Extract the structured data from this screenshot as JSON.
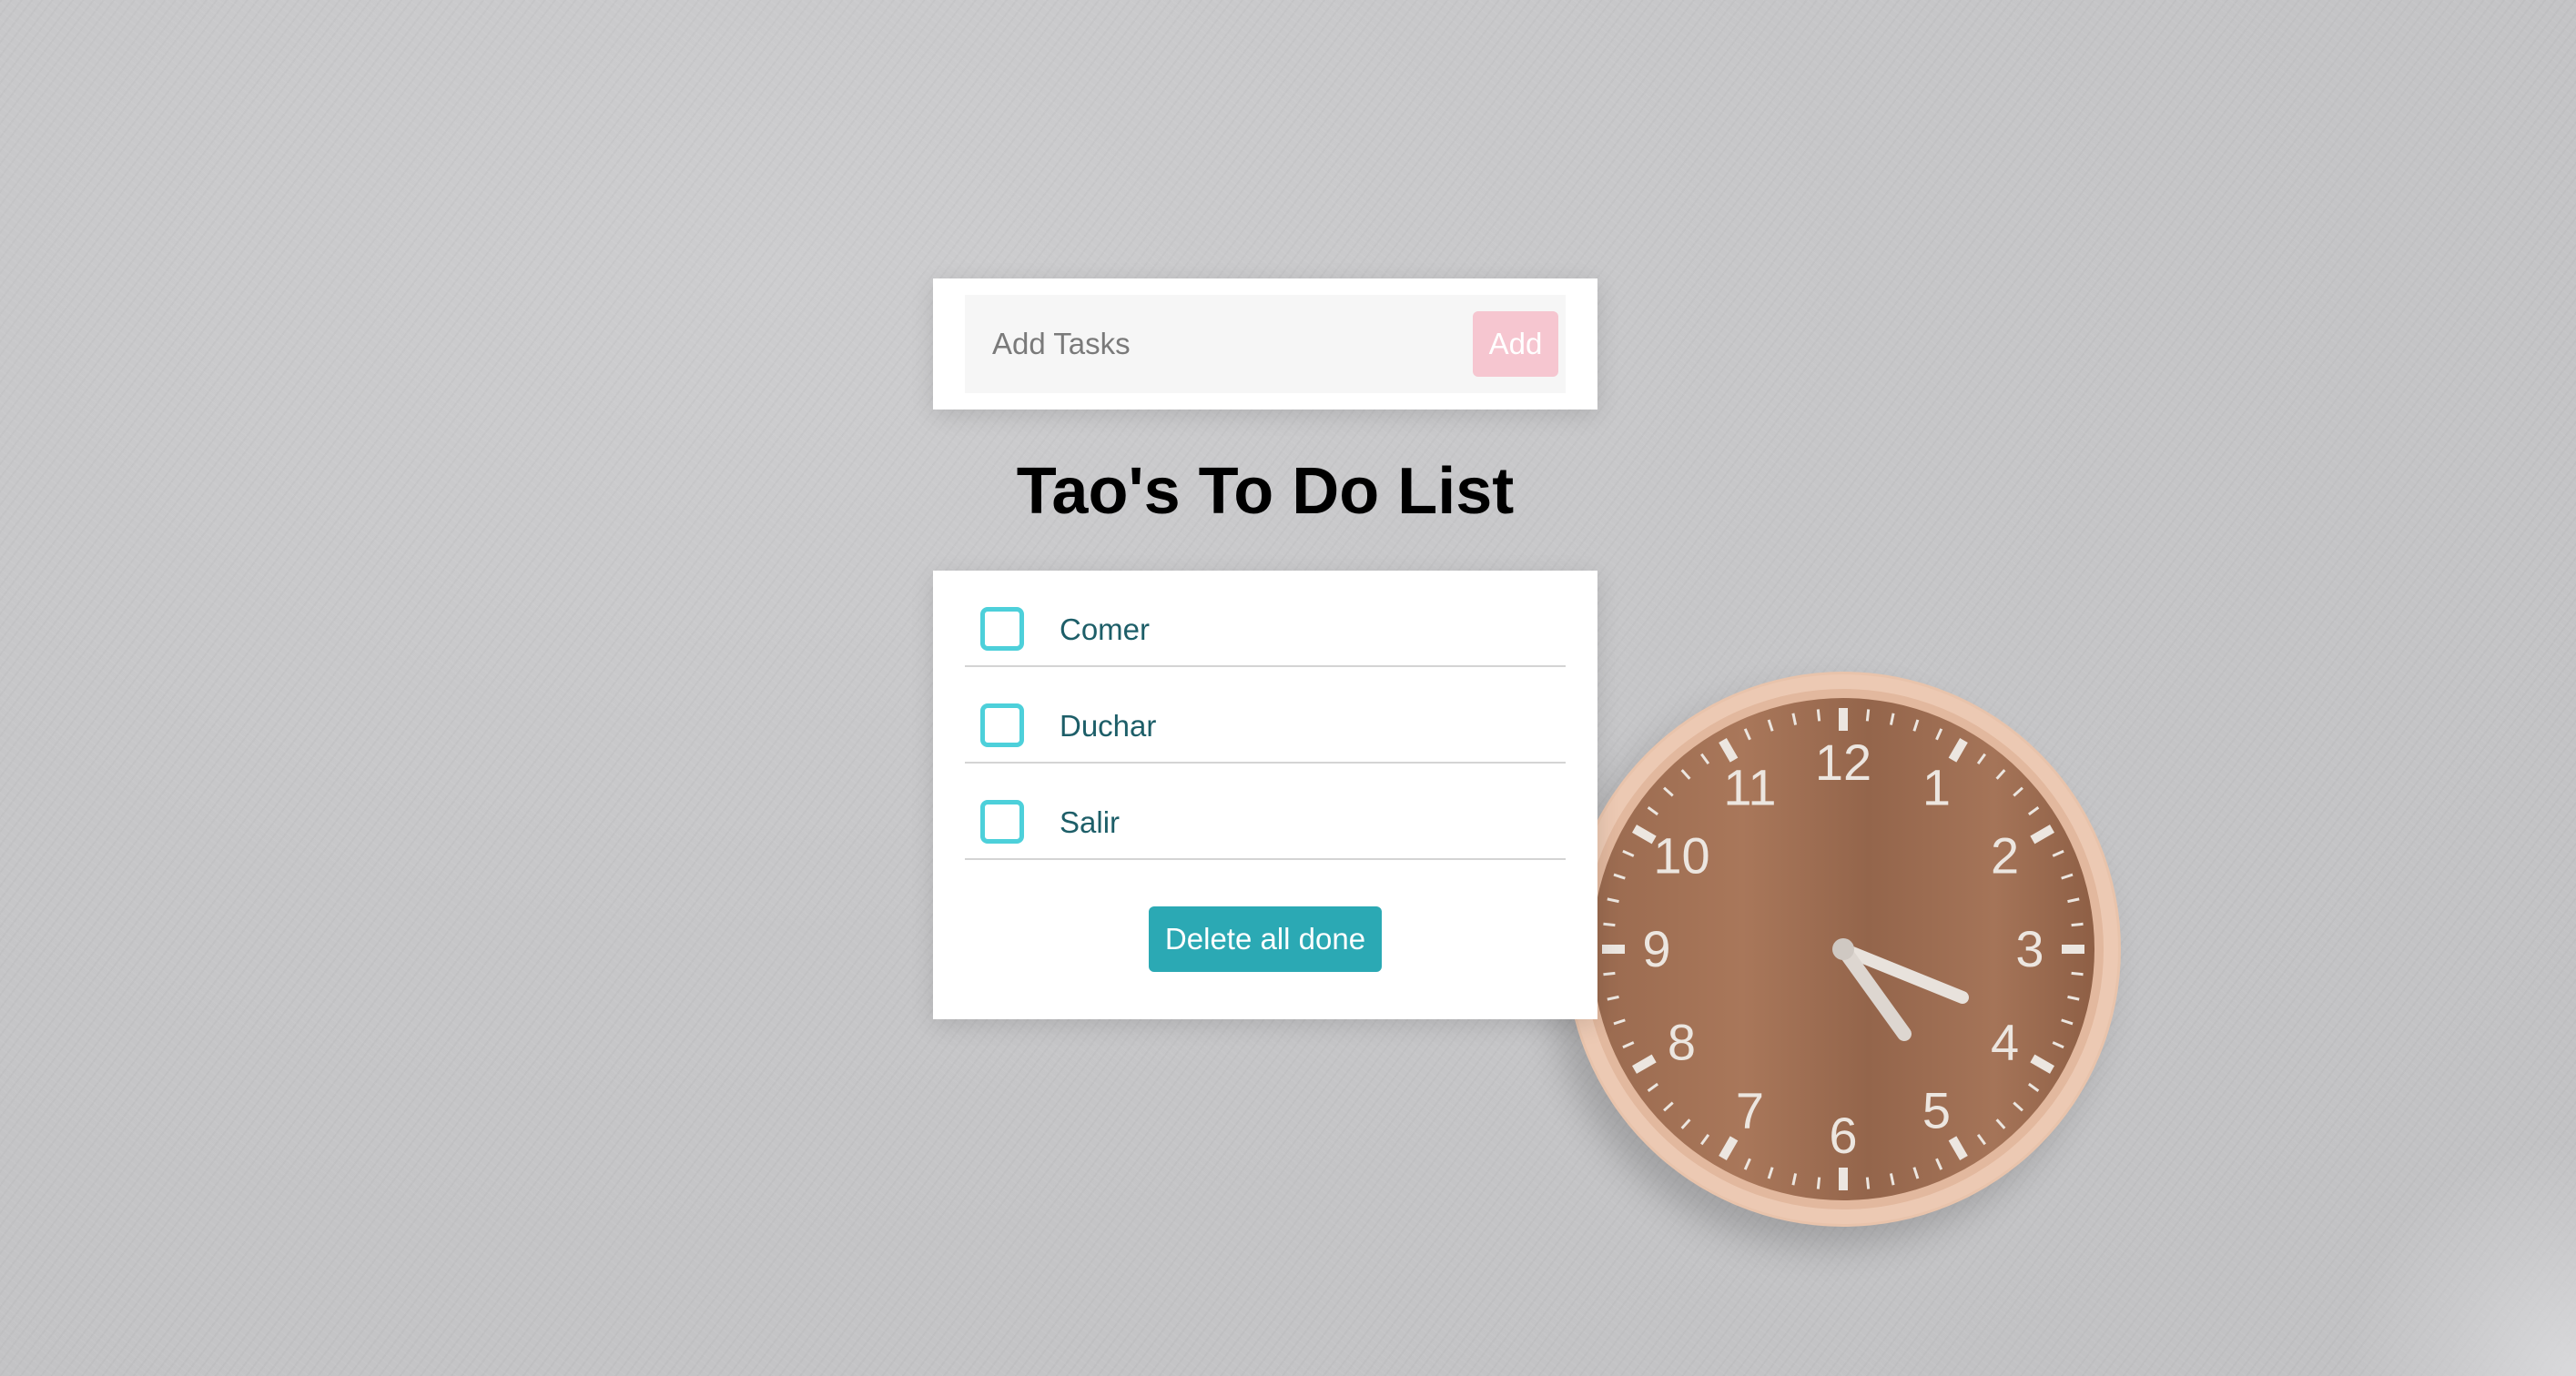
{
  "header": {
    "input_placeholder": "Add Tasks",
    "add_label": "Add"
  },
  "title": "Tao's To Do List",
  "tasks": [
    {
      "label": "Comer",
      "done": false
    },
    {
      "label": "Duchar",
      "done": false
    },
    {
      "label": "Salir",
      "done": false
    }
  ],
  "delete_label": "Delete all done",
  "colors": {
    "add_button": "#f6c6d0",
    "delete_button": "#2ba9b4",
    "checkbox_border": "#4dd0da",
    "task_text": "#1d5e68"
  },
  "background": {
    "clock_numbers": [
      "12",
      "1",
      "2",
      "3",
      "4",
      "5",
      "6",
      "7",
      "8",
      "9",
      "10",
      "11"
    ]
  }
}
